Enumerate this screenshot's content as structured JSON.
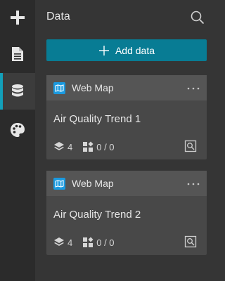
{
  "rail": {
    "items": [
      {
        "icon": "plus-icon",
        "active": false
      },
      {
        "icon": "page-icon",
        "active": false
      },
      {
        "icon": "database-icon",
        "active": true
      },
      {
        "icon": "palette-icon",
        "active": false
      }
    ]
  },
  "panel": {
    "title": "Data",
    "add_label": "Add data"
  },
  "cards": [
    {
      "type": "Web Map",
      "title": "Air Quality Trend 1",
      "layers": "4",
      "widgets": "0 / 0"
    },
    {
      "type": "Web Map",
      "title": "Air Quality Trend 2",
      "layers": "4",
      "widgets": "0 / 0"
    }
  ],
  "colors": {
    "accent": "#13a0ba",
    "button": "#087c94",
    "map_badge": "#1a9ae0"
  }
}
